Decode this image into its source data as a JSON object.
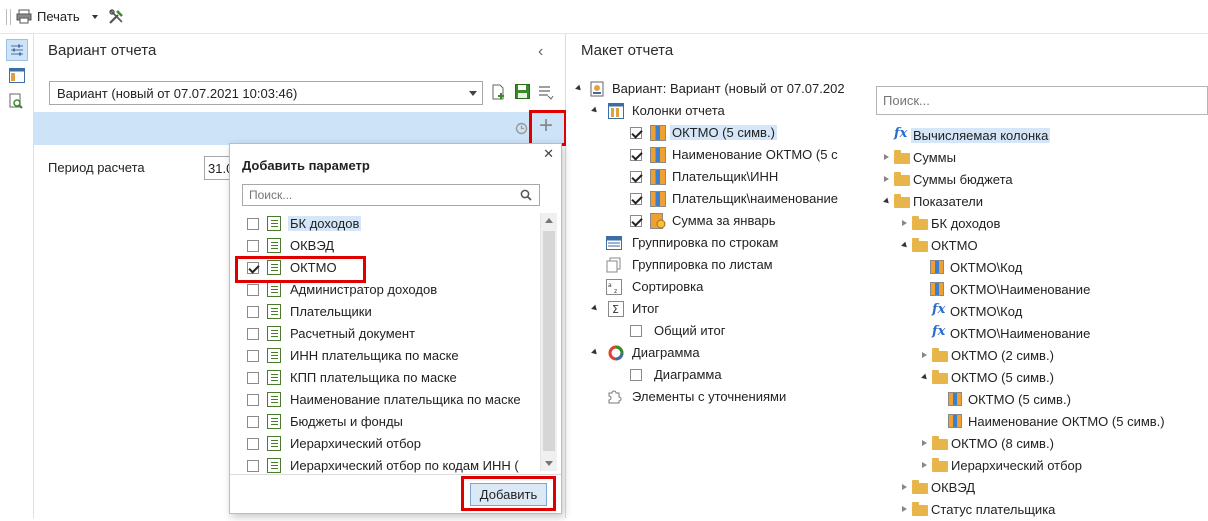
{
  "toolbar": {
    "print_label": "Печать"
  },
  "left_panel": {
    "title": "Вариант отчета",
    "variant_value": "Вариант (новый от 07.07.2021 10:03:46)",
    "period_label": "Период расчета",
    "period_value": "31.0"
  },
  "popup": {
    "title": "Добавить параметр",
    "search_placeholder": "Поиск...",
    "add_button": "Добавить",
    "items": [
      {
        "label": "БК доходов",
        "checked": false,
        "selected": true
      },
      {
        "label": "ОКВЭД",
        "checked": false,
        "selected": false
      },
      {
        "label": "ОКТМО",
        "checked": true,
        "selected": false
      },
      {
        "label": "Администратор доходов",
        "checked": false,
        "selected": false
      },
      {
        "label": "Плательщики",
        "checked": false,
        "selected": false
      },
      {
        "label": "Расчетный документ",
        "checked": false,
        "selected": false
      },
      {
        "label": "ИНН плательщика по маске",
        "checked": false,
        "selected": false
      },
      {
        "label": "КПП плательщика по маске",
        "checked": false,
        "selected": false
      },
      {
        "label": "Наименование плательщика по маске",
        "checked": false,
        "selected": false
      },
      {
        "label": "Бюджеты и фонды",
        "checked": false,
        "selected": false
      },
      {
        "label": "Иерархический отбор",
        "checked": false,
        "selected": false
      },
      {
        "label": "Иерархический отбор по кодам ИНН (",
        "checked": false,
        "selected": false
      }
    ]
  },
  "right_panel": {
    "title": "Макет отчета",
    "search_placeholder": "Поиск...",
    "layout_tree": {
      "variant": "Вариант: Вариант (новый от 07.07.202",
      "columns": "Колонки отчета",
      "column_items": [
        "ОКТМО (5 симв.)",
        "Наименование ОКТМО (5 с",
        "Плательщик\\ИНН",
        "Плательщик\\наименование",
        "Сумма за январь"
      ],
      "row_grouping": "Группировка по строкам",
      "sheet_grouping": "Группировка по листам",
      "sorting": "Сортировка",
      "total": "Итог",
      "total_child": "Общий итог",
      "chart": "Диаграмма",
      "chart_child": "Диаграмма",
      "refinements": "Элементы с уточнениями"
    },
    "field_tree": {
      "calc_column": "Вычисляемая колонка",
      "sums": "Суммы",
      "budget_sums": "Суммы бюджета",
      "indicators": "Показатели",
      "bk_income": "БК доходов",
      "oktmo": "ОКТМО",
      "oktmo_children": [
        "ОКТМО\\Код",
        "ОКТМО\\Наименование",
        "ОКТМО\\Код",
        "ОКТМО\\Наименование"
      ],
      "oktmo2": "ОКТМО (2 симв.)",
      "oktmo5": "ОКТМО (5 симв.)",
      "oktmo5_children": [
        "ОКТМО (5 симв.)",
        "Наименование ОКТМО (5 симв.)"
      ],
      "oktmo8": "ОКТМО (8 симв.)",
      "hier_select": "Иерархический отбор",
      "okved": "ОКВЭД",
      "payer_status": "Статус плательщика"
    }
  },
  "colors": {
    "accent_blue": "#cde3f7",
    "highlight_red": "#e00000",
    "selection": "#d4e6f7"
  }
}
